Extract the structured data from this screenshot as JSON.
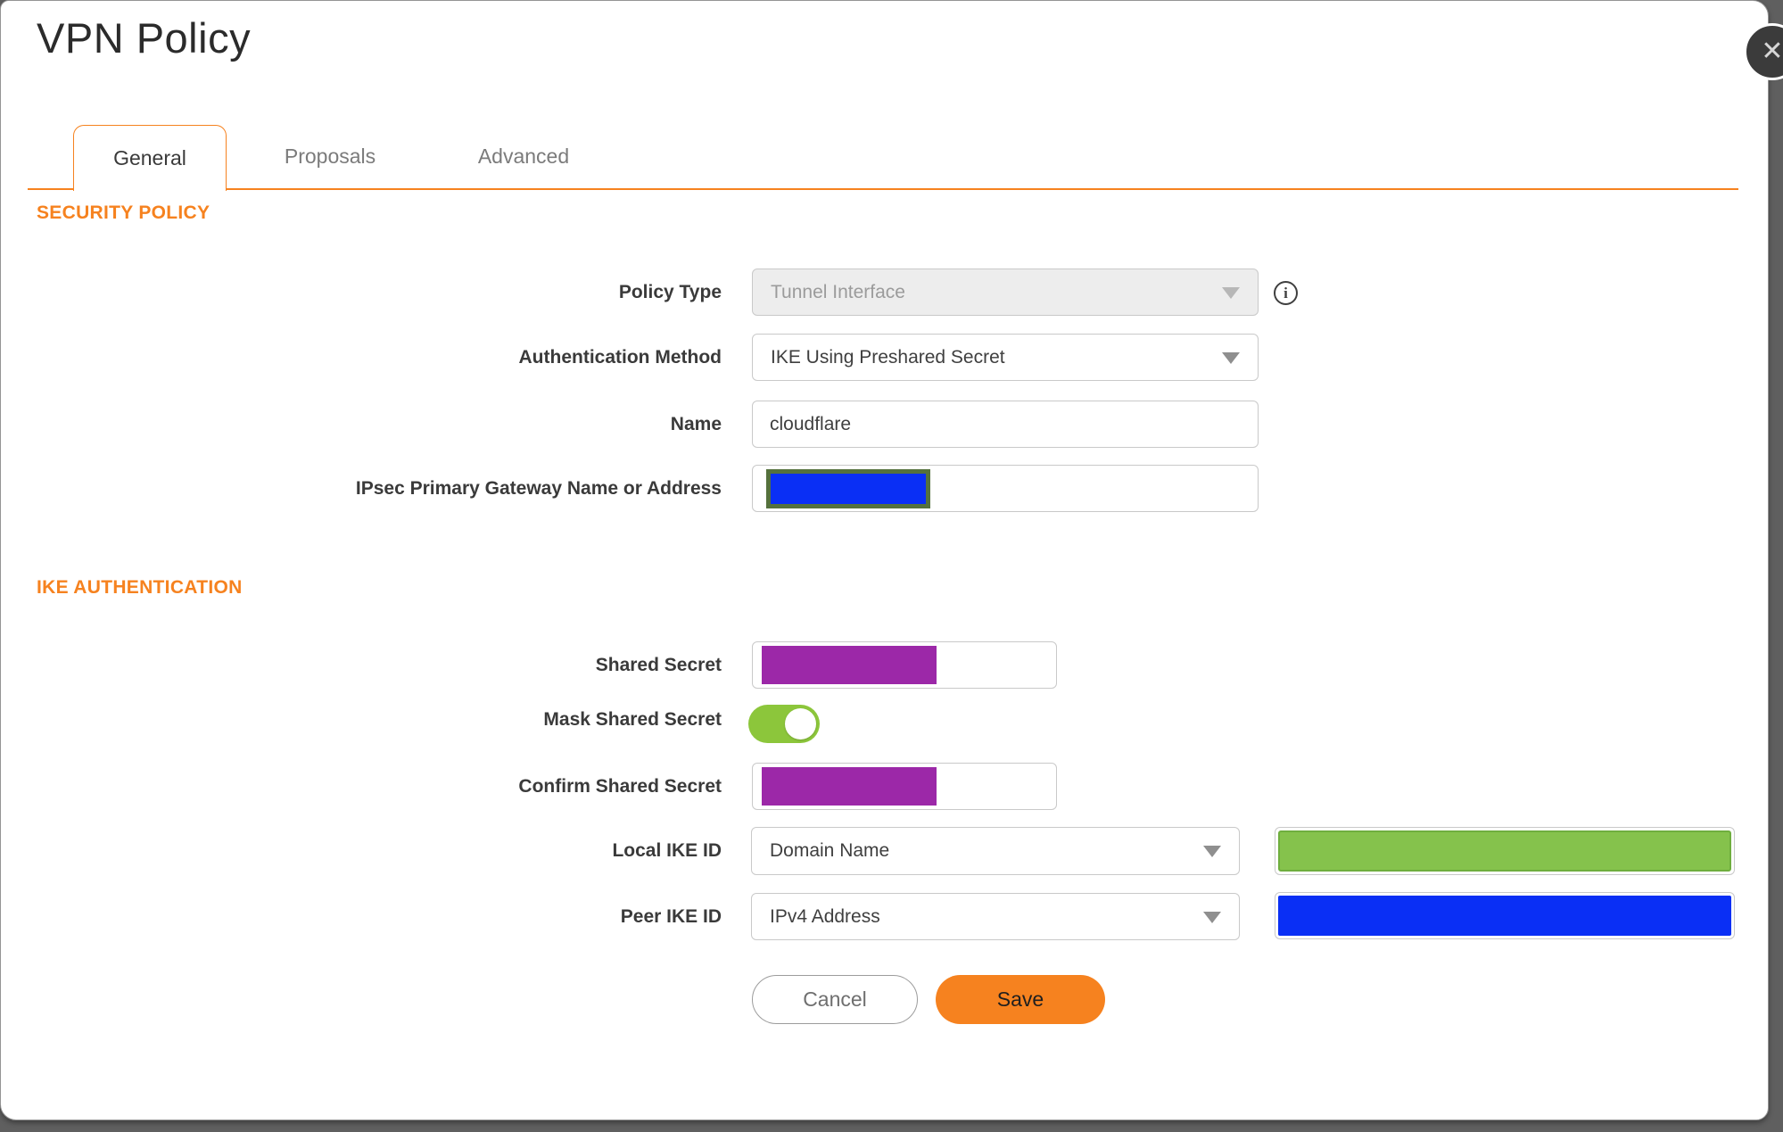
{
  "dialog": {
    "title": "VPN Policy"
  },
  "icons": {
    "close": "✕",
    "info": "i"
  },
  "tabs": {
    "general": "General",
    "proposals": "Proposals",
    "advanced": "Advanced",
    "active_tab": "General"
  },
  "sections": {
    "security_policy": "SECURITY POLICY",
    "ike_authentication": "IKE AUTHENTICATION"
  },
  "fields": {
    "policy_type": {
      "label": "Policy Type",
      "value": "Tunnel Interface",
      "disabled": true
    },
    "authentication_method": {
      "label": "Authentication Method",
      "value": "IKE Using Preshared Secret"
    },
    "name": {
      "label": "Name",
      "value": "cloudflare"
    },
    "ipsec_primary_gateway": {
      "label": "IPsec Primary Gateway Name or Address",
      "value_redacted": true
    },
    "shared_secret": {
      "label": "Shared Secret",
      "value_redacted": true
    },
    "mask_shared_secret": {
      "label": "Mask Shared Secret",
      "toggle_on": true
    },
    "confirm_shared_secret": {
      "label": "Confirm Shared Secret",
      "value_redacted": true
    },
    "local_ike_id": {
      "label": "Local IKE ID",
      "value": "Domain Name",
      "id_value_redacted": true
    },
    "peer_ike_id": {
      "label": "Peer IKE ID",
      "value": "IPv4 Address",
      "id_value_redacted": true
    }
  },
  "actions": {
    "cancel": "Cancel",
    "save": "Save"
  },
  "colors": {
    "accent_orange": "#F6821F",
    "redaction_blue": "#0A2FF5",
    "redaction_purple": "#9C28A8",
    "redaction_green": "#85C24C",
    "redaction_olive_border": "#55713D",
    "toggle_on_green": "#8CC63B",
    "page_background": "#5F5F5F"
  }
}
